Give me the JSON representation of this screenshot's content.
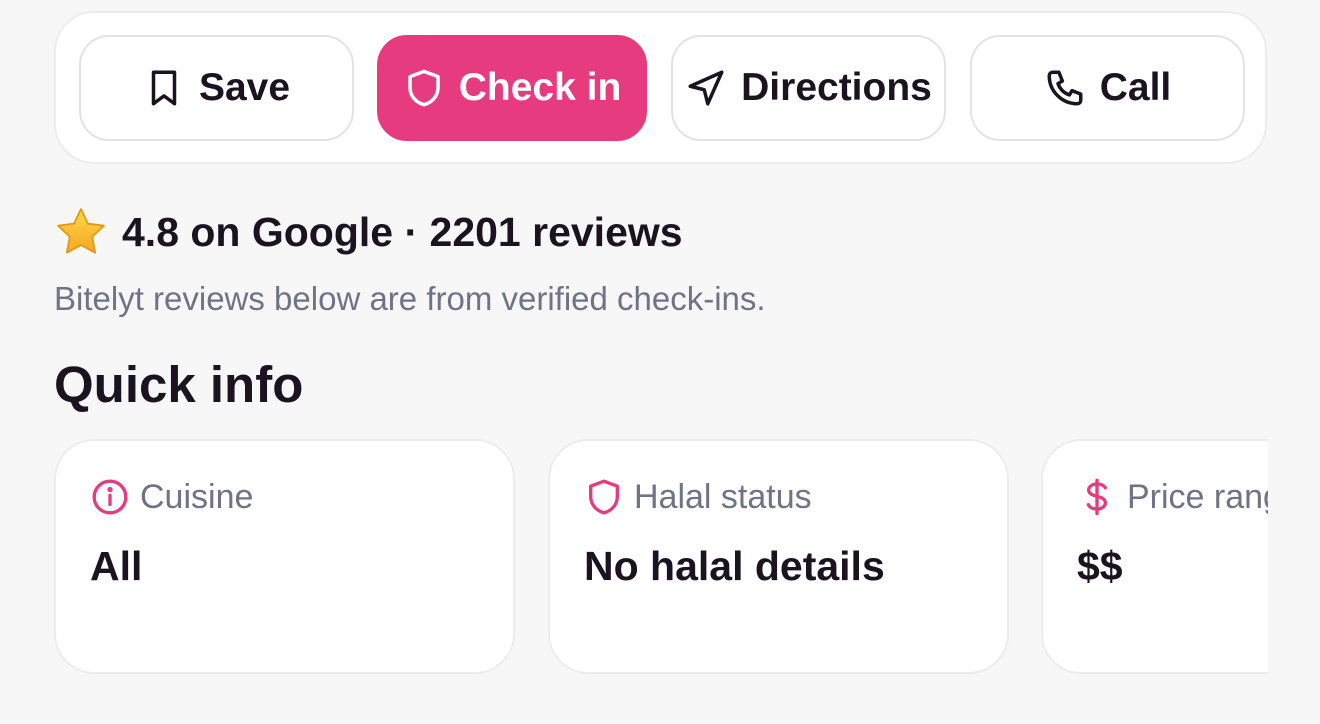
{
  "actions": {
    "save_label": "Save",
    "checkin_label": "Check in",
    "directions_label": "Directions",
    "call_label": "Call"
  },
  "rating": {
    "icon": "star-icon",
    "text": "4.8 on Google · 2201 reviews",
    "note": "Bitelyt reviews below are from verified check-ins."
  },
  "quick_info": {
    "title": "Quick info",
    "cards": [
      {
        "icon": "info-icon",
        "label": "Cuisine",
        "value": "All"
      },
      {
        "icon": "shield-icon",
        "label": "Halal status",
        "value": "No halal details"
      },
      {
        "icon": "dollar-icon",
        "label": "Price range",
        "value": "$$"
      }
    ]
  },
  "colors": {
    "accent": "#e63b7f",
    "text_primary": "#1c1320",
    "text_muted": "#6e7385",
    "background": "#f7f7f8"
  }
}
